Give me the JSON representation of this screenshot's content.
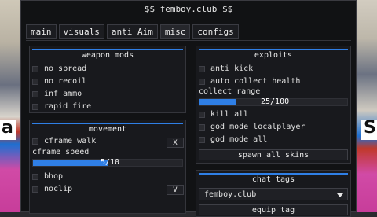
{
  "window": {
    "title": "$$ femboy.club $$"
  },
  "tabs": [
    {
      "label": "main"
    },
    {
      "label": "visuals"
    },
    {
      "label": "anti Aim"
    },
    {
      "label": "misc"
    },
    {
      "label": "configs"
    }
  ],
  "active_tab": "misc",
  "weapon_mods": {
    "title": "weapon mods",
    "items": [
      {
        "label": "no spread",
        "checked": false
      },
      {
        "label": "no recoil",
        "checked": false
      },
      {
        "label": "inf ammo",
        "checked": false
      },
      {
        "label": "rapid fire",
        "checked": false
      }
    ]
  },
  "movement": {
    "title": "movement",
    "cframe_walk": {
      "label": "cframe walk",
      "checked": false,
      "key": "X"
    },
    "cframe_speed": {
      "label": "cframe speed",
      "value_text": "5/10",
      "value": 5,
      "max": 10
    },
    "bhop": {
      "label": "bhop",
      "checked": false
    },
    "noclip": {
      "label": "noclip",
      "checked": false,
      "key": "V"
    }
  },
  "exploits": {
    "title": "exploits",
    "anti_kick": {
      "label": "anti kick",
      "checked": false
    },
    "auto_collect": {
      "label": "auto collect health",
      "checked": false
    },
    "collect_range": {
      "label": "collect range",
      "value_text": "25/100",
      "value": 25,
      "max": 100
    },
    "kill_all": {
      "label": "kill all",
      "checked": false
    },
    "god_local": {
      "label": "god mode localplayer",
      "checked": false
    },
    "god_all": {
      "label": "god mode all",
      "checked": false
    },
    "spawn_button": "spawn all skins"
  },
  "chat_tags": {
    "title": "chat tags",
    "selected": "femboy.club",
    "equip_button": "equip tag"
  },
  "colors": {
    "accent": "#2f7fe6",
    "panel": "#18191d",
    "window": "#111214"
  }
}
